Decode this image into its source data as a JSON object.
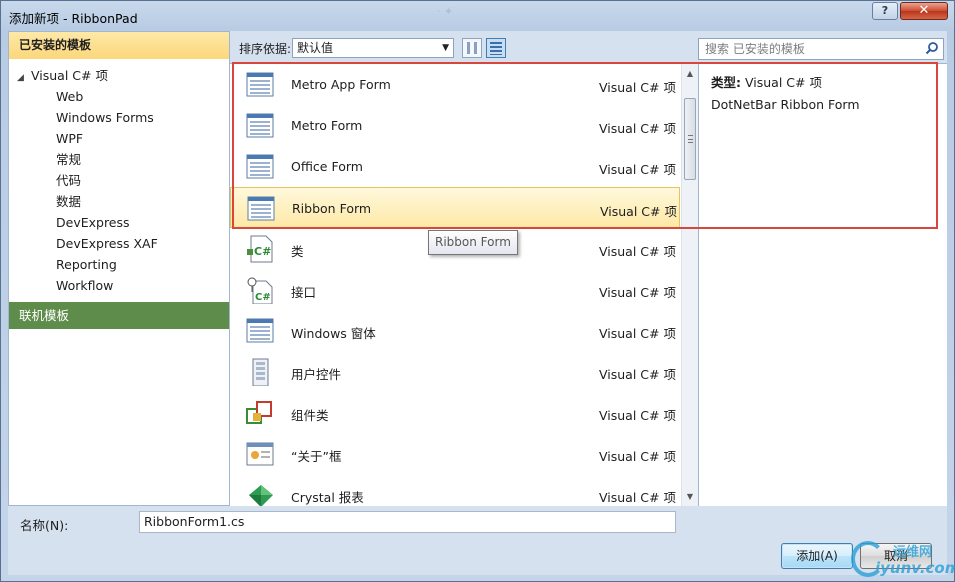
{
  "window": {
    "title": "添加新项 - RibbonPad",
    "title_watermark": "·     ✦    ",
    "help_label": "?",
    "close_label": "✕"
  },
  "sidebar": {
    "installed_header": "已安装的模板",
    "root": "Visual C# 项",
    "items": [
      "Web",
      "Windows Forms",
      "WPF",
      "常规",
      "代码",
      "数据",
      "DevExpress",
      "DevExpress XAF",
      "Reporting",
      "Workflow"
    ],
    "online_header": "联机模板"
  },
  "toolbar": {
    "sort_label": "排序依据:",
    "sort_value": "默认值",
    "search_placeholder": "搜索 已安装的模板"
  },
  "templates": [
    {
      "name": "Metro App Form",
      "type": "Visual C# 项",
      "icon": "form-icon"
    },
    {
      "name": "Metro Form",
      "type": "Visual C# 项",
      "icon": "form-icon"
    },
    {
      "name": "Office Form",
      "type": "Visual C# 项",
      "icon": "form-icon"
    },
    {
      "name": "Ribbon Form",
      "type": "Visual C# 项",
      "icon": "form-icon",
      "selected": true
    },
    {
      "name": "类",
      "type": "Visual C# 项",
      "icon": "class-icon"
    },
    {
      "name": "接口",
      "type": "Visual C# 项",
      "icon": "interface-icon"
    },
    {
      "name": "Windows 窗体",
      "type": "Visual C# 项",
      "icon": "form-icon"
    },
    {
      "name": "用户控件",
      "type": "Visual C# 项",
      "icon": "user-control-icon"
    },
    {
      "name": "组件类",
      "type": "Visual C# 项",
      "icon": "component-icon"
    },
    {
      "name": "“关于”框",
      "type": "Visual C# 项",
      "icon": "about-box-icon"
    },
    {
      "name": "Crystal 报表",
      "type": "Visual C# 项",
      "icon": "crystal-report-icon"
    }
  ],
  "tooltip": "Ribbon Form",
  "details": {
    "type_label": "类型:",
    "type_value": "Visual C# 项",
    "description": "DotNetBar Ribbon Form"
  },
  "footer": {
    "name_label": "名称(N):",
    "name_value": "RibbonForm1.cs",
    "add_label": "添加(A)",
    "cancel_label": "取消"
  },
  "watermark": {
    "cn": "运维网",
    "en": "iyunv.com"
  },
  "colors": {
    "selection": "#fde9a6",
    "online_header": "#5e8c4a",
    "highlight_border": "#d9473c"
  }
}
